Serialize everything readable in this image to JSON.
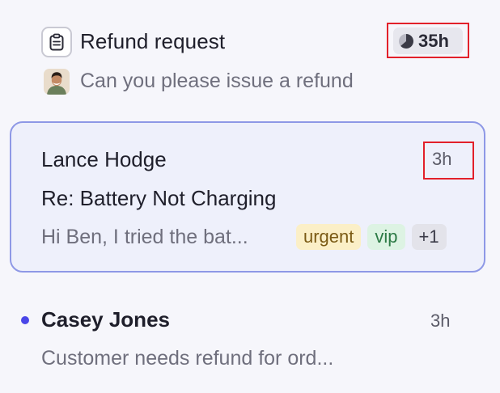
{
  "conversations": [
    {
      "icon": "clipboard-icon",
      "subject": "Refund request",
      "sla": "35h",
      "sla_icon": "pie-clock-icon",
      "preview": "Can you please issue a refund",
      "selected": false
    },
    {
      "name": "Lance Hodge",
      "time": "3h",
      "subject": "Re: Battery Not Charging",
      "preview": "Hi Ben, I tried the bat...",
      "tags": [
        "urgent",
        "vip",
        "+1"
      ],
      "selected": true
    },
    {
      "name": "Casey Jones",
      "time": "3h",
      "preview": "Customer needs refund for ord...",
      "unread": true,
      "selected": false
    }
  ],
  "colors": {
    "background": "#f6f6fb",
    "selected_bg": "#eef0fb",
    "selected_border": "#8e98e6",
    "highlight_red": "#e2202a",
    "unread_dot": "#4a46e8",
    "tag_urgent_bg": "#fbefc7",
    "tag_vip_bg": "#ddf3e3"
  }
}
